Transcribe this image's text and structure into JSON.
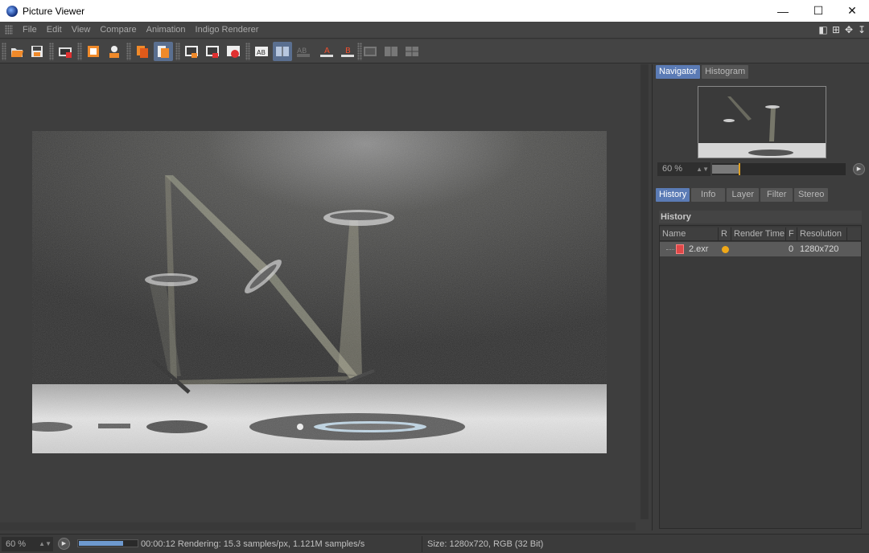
{
  "window": {
    "title": "Picture Viewer",
    "controls": {
      "minimize": "—",
      "maximize": "☐",
      "close": "✕"
    }
  },
  "menu": {
    "items": [
      "File",
      "Edit",
      "View",
      "Compare",
      "Animation",
      "Indigo Renderer"
    ]
  },
  "toolbar": {
    "buttons": [
      {
        "name": "open-icon"
      },
      {
        "name": "save-icon"
      },
      {
        "name": "film-settings-icon"
      },
      {
        "name": "render-region-icon"
      },
      {
        "name": "render-settings-icon"
      },
      {
        "name": "copy-layer-icon"
      },
      {
        "name": "paste-layer-icon"
      },
      {
        "name": "region-a-icon"
      },
      {
        "name": "region-b-icon"
      },
      {
        "name": "region-c-icon"
      },
      {
        "name": "compare-ab-icon"
      },
      {
        "name": "compare-split-icon"
      },
      {
        "name": "compare-diff-icon"
      },
      {
        "name": "set-a-icon"
      },
      {
        "name": "set-b-icon"
      },
      {
        "name": "view-1-icon"
      },
      {
        "name": "view-2-icon"
      },
      {
        "name": "view-3-icon"
      }
    ]
  },
  "navigator": {
    "tabs": [
      "Navigator",
      "Histogram"
    ],
    "active_tab": "Navigator",
    "zoom_value": "60 %",
    "zoom_fraction": 0.2
  },
  "panel": {
    "tabs": [
      "History",
      "Info",
      "Layer",
      "Filter",
      "Stereo"
    ],
    "active_tab": "History",
    "section_title": "History",
    "columns": [
      "Name",
      "R",
      "Render Time",
      "F",
      "Resolution"
    ],
    "rows": [
      {
        "name": "2.exr",
        "r_status": "rendering",
        "render_time": "",
        "f": "0",
        "resolution": "1280x720"
      }
    ]
  },
  "status": {
    "zoom": "60 %",
    "progress_fraction": 0.76,
    "render_info": "00:00:12 Rendering: 15.3 samples/px, 1.121M samples/s",
    "size_info": "Size: 1280x720, RGB (32 Bit)"
  },
  "colors": {
    "accent_tab": "#5b7bb5",
    "status_dot": "#f0a818",
    "progress": "#6e9ad0"
  }
}
